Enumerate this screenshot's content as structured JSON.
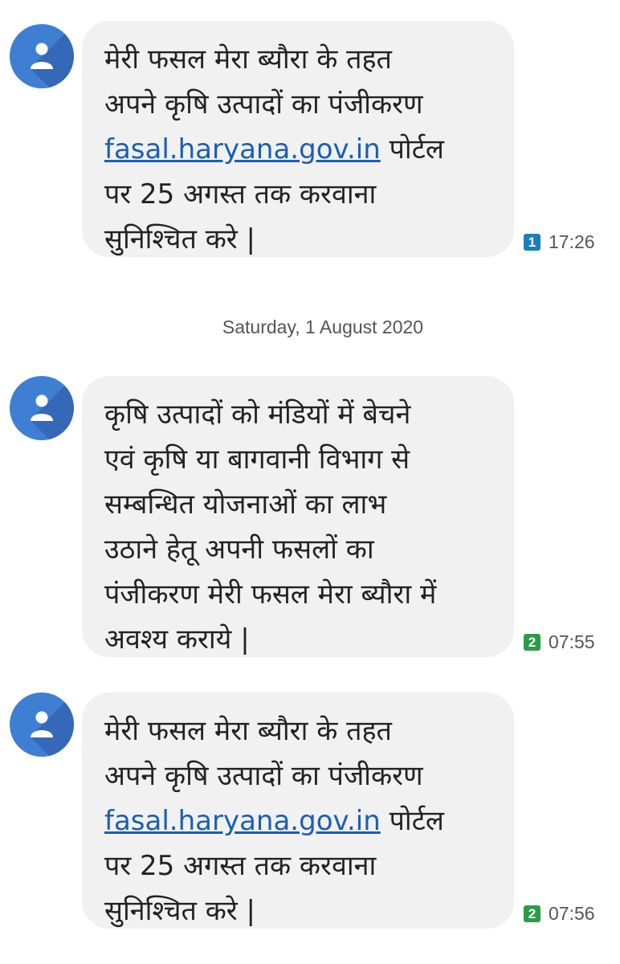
{
  "sim_colors": {
    "sim1": "#1b7fb8",
    "sim2": "#2c9b4a"
  },
  "accent_color": "#3f7fd3",
  "date_separator": "Saturday, 1 August 2020",
  "messages": [
    {
      "avatar_icon": "person-icon",
      "text_before_link": "मेरी फसल मेरा ब्यौरा के तहत\nअपने कृषि उत्पादों का पंजीकरण\n",
      "link": "fasal.haryana.gov.in",
      "text_after_link": " पोर्टल\nपर 25 अगस्त तक करवाना\nसुनिश्चित करे |",
      "sim": "1",
      "time": "17:26"
    },
    {
      "avatar_icon": "person-icon",
      "text": "कृषि उत्पादों को मंडियों में बेचने\nएवं कृषि या बागवानी विभाग से\nसम्बन्धित योजनाओं का लाभ\nउठाने हेतू अपनी फसलों का\nपंजीकरण मेरी फसल मेरा ब्यौरा में\nअवश्य कराये |",
      "sim": "2",
      "time": "07:55"
    },
    {
      "avatar_icon": "person-icon",
      "text_before_link": "मेरी फसल मेरा ब्यौरा के तहत\nअपने कृषि उत्पादों का पंजीकरण\n",
      "link": "fasal.haryana.gov.in",
      "text_after_link": " पोर्टल\nपर 25 अगस्त तक करवाना\nसुनिश्चित करे |",
      "sim": "2",
      "time": "07:56"
    }
  ]
}
